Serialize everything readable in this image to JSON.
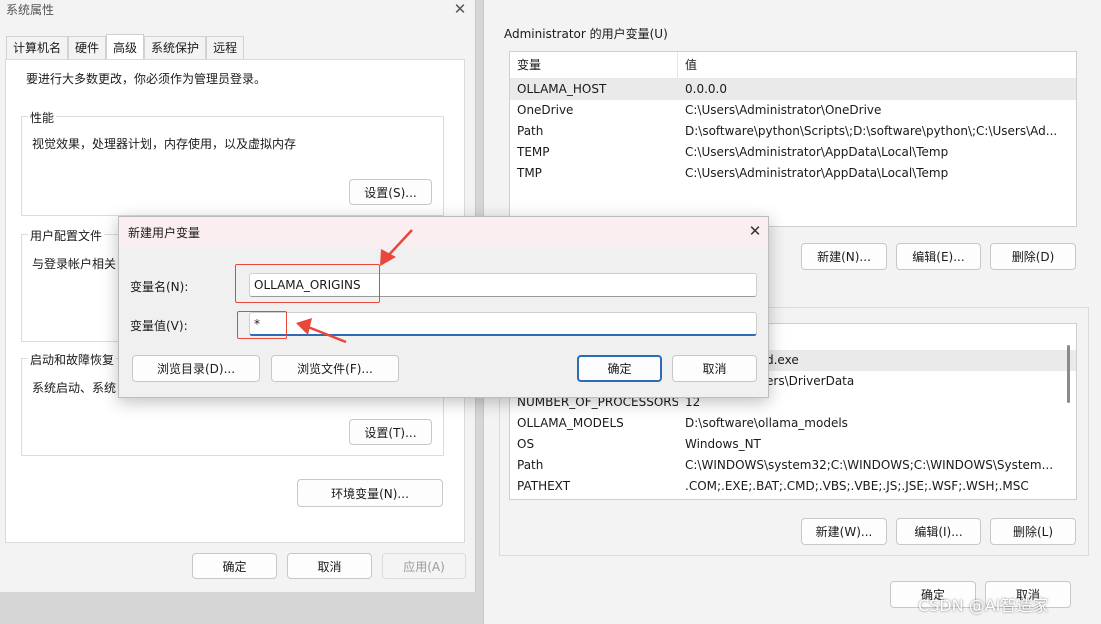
{
  "system_properties": {
    "title": "系统属性",
    "close_glyph": "✕",
    "tabs": [
      {
        "label": "计算机名"
      },
      {
        "label": "硬件"
      },
      {
        "label": "高级",
        "active": true
      },
      {
        "label": "系统保护"
      },
      {
        "label": "远程"
      }
    ],
    "admin_note": "要进行大多数更改，你必须作为管理员登录。",
    "performance": {
      "label": "性能",
      "description": "视觉效果，处理器计划，内存使用，以及虚拟内存",
      "settings_button": "设置(S)..."
    },
    "user_profiles": {
      "label": "用户配置文件",
      "description": "与登录帐户相关"
    },
    "startup_recovery": {
      "label": "启动和故障恢复",
      "description": "系统启动、系统",
      "settings_button": "设置(T)..."
    },
    "env_vars_button": "环境变量(N)...",
    "ok_button": "确定",
    "cancel_button": "取消",
    "apply_button": "应用(A)"
  },
  "environment_variables": {
    "user_vars_label": "Administrator 的用户变量(U)",
    "columns": {
      "name": "变量",
      "value": "值"
    },
    "user_vars": [
      {
        "name": "OLLAMA_HOST",
        "value": "0.0.0.0"
      },
      {
        "name": "OneDrive",
        "value": "C:\\Users\\Administrator\\OneDrive"
      },
      {
        "name": "Path",
        "value": "D:\\software\\python\\Scripts\\;D:\\software\\python\\;C:\\Users\\Ad..."
      },
      {
        "name": "TEMP",
        "value": "C:\\Users\\Administrator\\AppData\\Local\\Temp"
      },
      {
        "name": "TMP",
        "value": "C:\\Users\\Administrator\\AppData\\Local\\Temp"
      }
    ],
    "user_buttons": {
      "new": "新建(N)...",
      "edit": "编辑(E)...",
      "delete": "删除(D)"
    },
    "system_vars": [
      {
        "name": "",
        "value": "system32\\cmd.exe"
      },
      {
        "name": "",
        "value": "ystem32\\Drivers\\DriverData"
      },
      {
        "name": "NUMBER_OF_PROCESSORS",
        "value": "12"
      },
      {
        "name": "OLLAMA_MODELS",
        "value": "D:\\software\\ollama_models"
      },
      {
        "name": "OS",
        "value": "Windows_NT"
      },
      {
        "name": "Path",
        "value": "C:\\WINDOWS\\system32;C:\\WINDOWS;C:\\WINDOWS\\System..."
      },
      {
        "name": "PATHEXT",
        "value": ".COM;.EXE;.BAT;.CMD;.VBS;.VBE;.JS;.JSE;.WSF;.WSH;.MSC"
      }
    ],
    "system_buttons": {
      "new": "新建(W)...",
      "edit": "编辑(I)...",
      "delete": "删除(L)"
    },
    "ok_button": "确定",
    "cancel_button": "取消"
  },
  "new_user_var_dialog": {
    "title": "新建用户变量",
    "close_glyph": "✕",
    "name_label": "变量名(N):",
    "value_label": "变量值(V):",
    "name_value": "OLLAMA_ORIGINS",
    "value_value": "*",
    "browse_dir_button": "浏览目录(D)...",
    "browse_file_button": "浏览文件(F)...",
    "ok_button": "确定",
    "cancel_button": "取消"
  },
  "annotation_color": "#e8473a",
  "watermark": "CSDN @AI智造家"
}
